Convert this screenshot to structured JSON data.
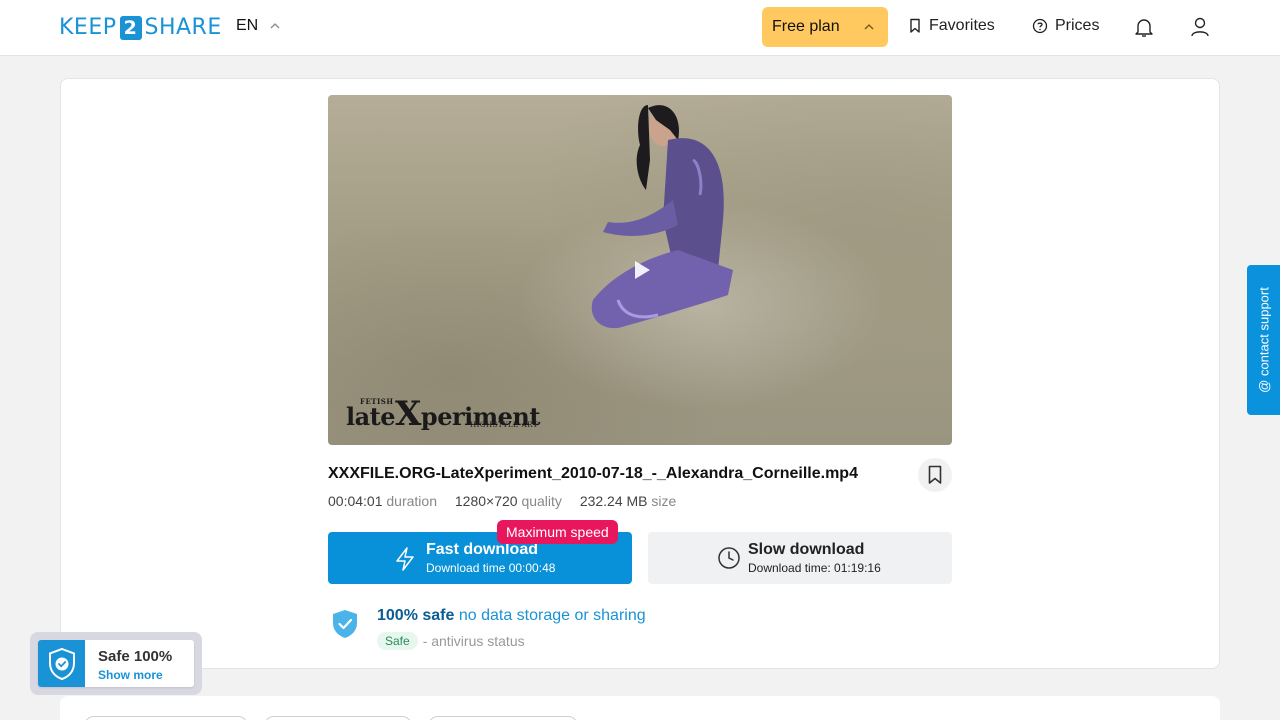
{
  "header": {
    "logo_left": "KEEP",
    "logo_num": "2",
    "logo_right": "SHARE",
    "language": "EN",
    "plan_label": "Free plan",
    "favorites_label": "Favorites",
    "prices_label": "Prices"
  },
  "video": {
    "watermark_small": "FETISH",
    "watermark_pre": "late",
    "watermark_x": "X",
    "watermark_post": "periment",
    "watermark_sub": "HIGHSTYLE ART"
  },
  "file": {
    "name": "XXXFILE.ORG-LateXperiment_2010-07-18_-_Alexandra_Corneille.mp4",
    "duration": "00:04:01",
    "duration_label": "duration",
    "quality": "1280×720",
    "quality_label": "quality",
    "size": "232.24 MB",
    "size_label": "size"
  },
  "download": {
    "badge": "Maximum speed",
    "fast_label": "Fast download",
    "fast_time": "Download time 00:00:48",
    "slow_label": "Slow download",
    "slow_time": "Download time: 01:19:16"
  },
  "safety": {
    "bold": "100% safe",
    "text": "no data storage or sharing",
    "badge": "Safe",
    "status": "- antivirus status"
  },
  "support": {
    "label": "@ contact support"
  },
  "safe_widget": {
    "title": "Safe 100%",
    "link": "Show more"
  },
  "colors": {
    "brand": "#1a93d6",
    "plan_bg": "#ffc960",
    "fast_bg": "#0891d8",
    "badge_bg": "#e8175d",
    "support_bg": "#0a93dc"
  }
}
